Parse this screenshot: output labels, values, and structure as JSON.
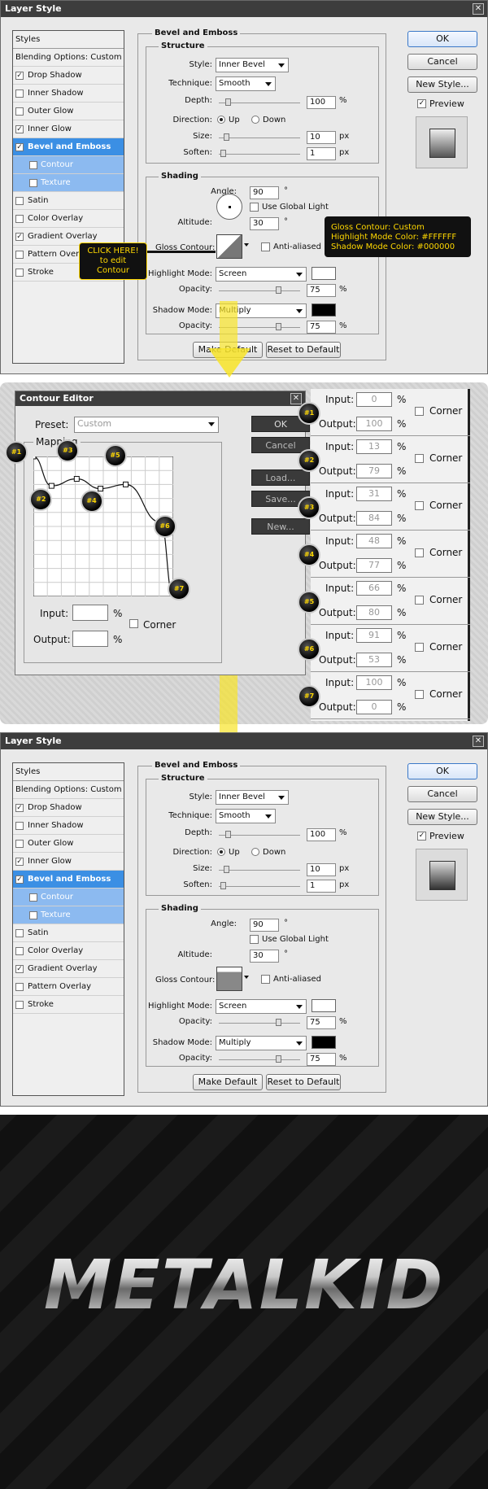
{
  "dialog1": {
    "title": "Layer Style",
    "close": "✕",
    "sidebar": [
      {
        "label": "Styles",
        "check": "none"
      },
      {
        "label": "Blending Options: Custom",
        "check": "none"
      },
      {
        "label": "Drop Shadow",
        "check": "on"
      },
      {
        "label": "Inner Shadow",
        "check": "off"
      },
      {
        "label": "Outer Glow",
        "check": "off"
      },
      {
        "label": "Inner Glow",
        "check": "on"
      },
      {
        "label": "Bevel and Emboss",
        "check": "on",
        "state": "sel"
      },
      {
        "label": "Contour",
        "check": "off",
        "state": "sub"
      },
      {
        "label": "Texture",
        "check": "off",
        "state": "sub"
      },
      {
        "label": "Satin",
        "check": "off"
      },
      {
        "label": "Color Overlay",
        "check": "off"
      },
      {
        "label": "Gradient Overlay",
        "check": "on"
      },
      {
        "label": "Pattern Overlay",
        "check": "off"
      },
      {
        "label": "Stroke",
        "check": "off"
      }
    ],
    "bevel_title": "Bevel and Emboss",
    "structure_title": "Structure",
    "style_label": "Style:",
    "style_value": "Inner Bevel",
    "technique_label": "Technique:",
    "technique_value": "Smooth",
    "depth_label": "Depth:",
    "depth_value": "100",
    "depth_unit": "%",
    "direction_label": "Direction:",
    "dir_up": "Up",
    "dir_down": "Down",
    "size_label": "Size:",
    "size_value": "10",
    "size_unit": "px",
    "soften_label": "Soften:",
    "soften_value": "1",
    "soften_unit": "px",
    "shading_title": "Shading",
    "angle_label": "Angle:",
    "angle_value": "90",
    "deg": "°",
    "global_light": "Use Global Light",
    "altitude_label": "Altitude:",
    "altitude_value": "30",
    "gloss_label": "Gloss Contour:",
    "anti_aliased": "Anti-aliased",
    "highlight_label": "Highlight Mode:",
    "highlight_value": "Screen",
    "opacity_label": "Opacity:",
    "opacity_value": "75",
    "pct": "%",
    "shadow_label": "Shadow Mode:",
    "shadow_value": "Multiply",
    "make_default": "Make Default",
    "reset_default": "Reset to Default",
    "ok": "OK",
    "cancel": "Cancel",
    "new_style": "New Style...",
    "preview": "Preview",
    "tooltip_click": "CLICK HERE!",
    "tooltip_click2": "to edit Contour",
    "info1": "Gloss Contour: Custom",
    "info2": "Highlight Mode Color: #FFFFFF",
    "info3": "Shadow Mode Color: #000000"
  },
  "contour": {
    "title": "Contour Editor",
    "preset_label": "Preset:",
    "preset_value": "Custom",
    "mapping": "Mapping",
    "input_label": "Input:",
    "output_label": "Output:",
    "pct": "%",
    "corner": "Corner",
    "ok": "OK",
    "cancel": "Cancel",
    "load": "Load...",
    "save": "Save...",
    "new": "New...",
    "points": [
      {
        "id": "#1",
        "input": "0",
        "output": "100"
      },
      {
        "id": "#2",
        "input": "13",
        "output": "79"
      },
      {
        "id": "#3",
        "input": "31",
        "output": "84"
      },
      {
        "id": "#4",
        "input": "48",
        "output": "77"
      },
      {
        "id": "#5",
        "input": "66",
        "output": "80"
      },
      {
        "id": "#6",
        "input": "91",
        "output": "53"
      },
      {
        "id": "#7",
        "input": "100",
        "output": "0"
      }
    ]
  },
  "metal_text": "METALKID",
  "colors": {
    "accent": "#3b8fe4",
    "sub": "#8cbaf0",
    "yellow": "#ffd800"
  }
}
